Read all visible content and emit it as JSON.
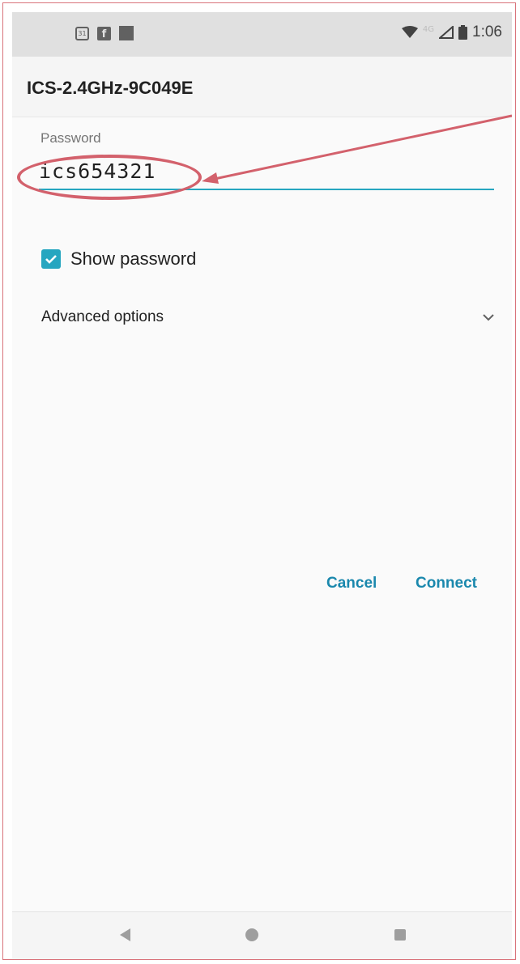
{
  "status_bar": {
    "time": "1:06",
    "network_type": "4G",
    "left_icons": [
      "calendar-icon",
      "facebook-icon",
      "square-notification-icon"
    ],
    "calendar_day": "31",
    "right_icons": [
      "wifi-icon",
      "cell-signal-icon",
      "battery-icon"
    ]
  },
  "dialog": {
    "title": "ICS-2.4GHz-9C049E",
    "password_label": "Password",
    "password_value": "ics654321",
    "show_password_label": "Show password",
    "show_password_checked": true,
    "advanced_options_label": "Advanced options",
    "cancel_label": "Cancel",
    "connect_label": "Connect"
  },
  "nav_bar": {
    "icons": [
      "back-icon",
      "home-icon",
      "recents-icon"
    ]
  },
  "colors": {
    "accent": "#26a6c0",
    "button_text": "#1a88ad",
    "annotation": "#d3616c"
  }
}
